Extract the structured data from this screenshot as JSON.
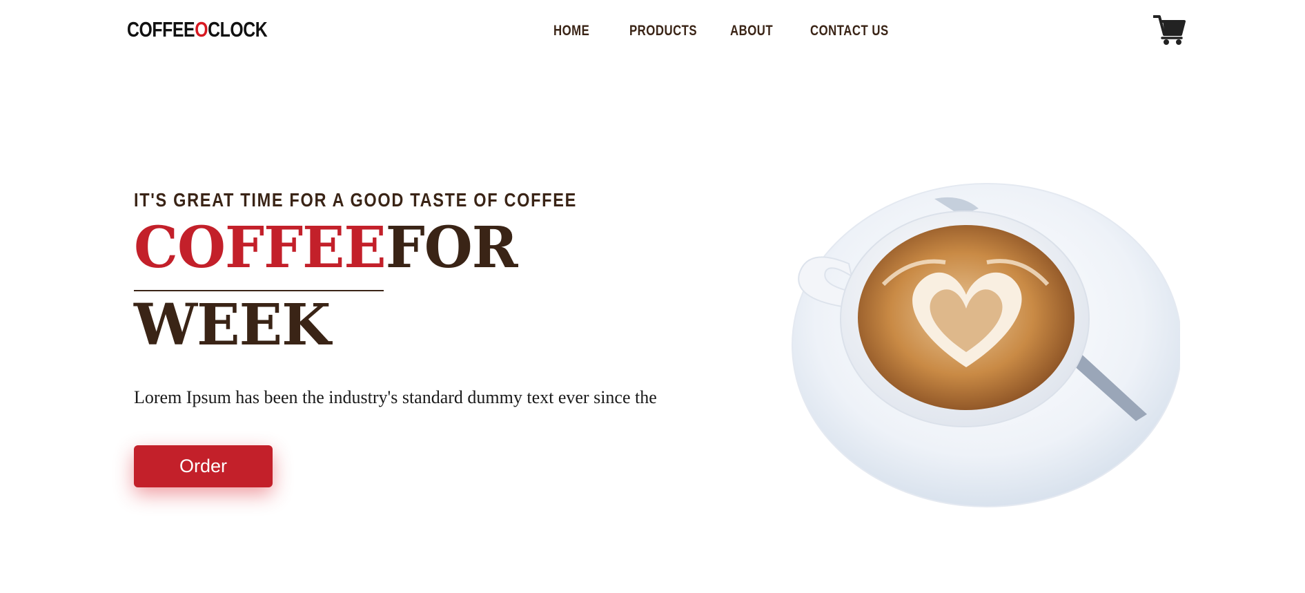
{
  "header": {
    "logo": {
      "part1": "COFFEE",
      "part2": "O",
      "part3": "CLOCK"
    },
    "nav": [
      "HOME",
      "PRODUCTS",
      "ABOUT",
      "CONTACT US"
    ],
    "cart_icon": "shopping-cart-icon"
  },
  "hero": {
    "subtitle": "IT'S GREAT TIME FOR A GOOD TASTE OF COFFEE",
    "title_red": "COFFEE",
    "title_dark": "FOR",
    "title_line2": "WEEK",
    "text": "Lorem Ipsum has been the industry's standard dummy text ever since the",
    "button_label": "Order",
    "image": "latte-art-coffee-cup"
  },
  "colors": {
    "accent": "#c3202a",
    "logo_accent": "#d71921",
    "text_dark": "#3a2416",
    "background": "#ffffff"
  }
}
